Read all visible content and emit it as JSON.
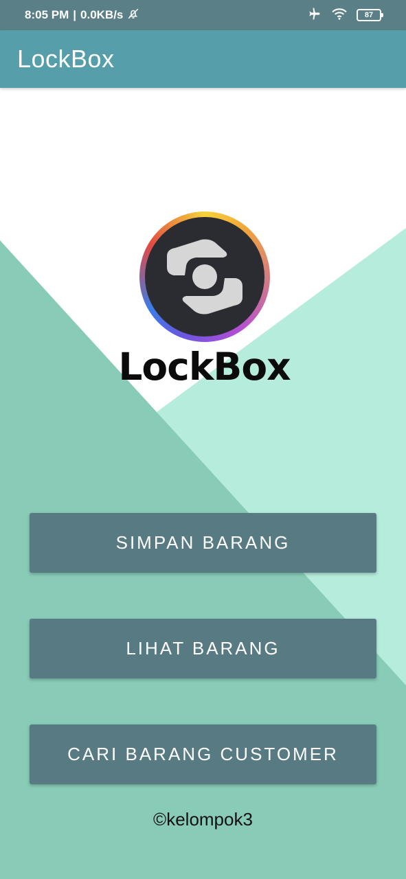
{
  "status_bar": {
    "time": "8:05 PM",
    "network_speed": "0.0KB/s",
    "battery": "87",
    "icons": [
      "bell-off-icon",
      "airplane-icon",
      "wifi-icon",
      "battery-icon"
    ]
  },
  "app_bar": {
    "title": "LockBox"
  },
  "logo": {
    "text": "LockBox"
  },
  "buttons": {
    "simpan": "SIMPAN BARANG",
    "lihat": "LIHAT BARANG",
    "cari": "CARI BARANG CUSTOMER"
  },
  "footer": {
    "text": "©kelompok3"
  },
  "colors": {
    "status_bar": "#5b7f86",
    "app_bar": "#569ea9",
    "button": "#587b83",
    "bg_dark_teal": "#88cbb7",
    "bg_light_teal": "#b6ecdc"
  }
}
